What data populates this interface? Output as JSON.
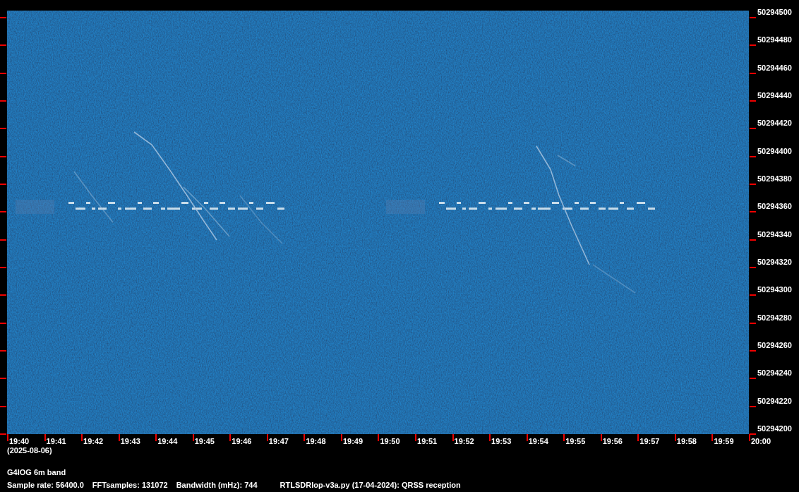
{
  "frequency_axis": {
    "labels": [
      "50294500",
      "50294480",
      "50294460",
      "50294440",
      "50294420",
      "50294400",
      "50294380",
      "50294360",
      "50294340",
      "50294320",
      "50294300",
      "50294280",
      "50294260",
      "50294240",
      "50294220",
      "50294200"
    ]
  },
  "time_axis": {
    "labels": [
      "19:40",
      "19:41",
      "19:42",
      "19:43",
      "19:44",
      "19:45",
      "19:46",
      "19:47",
      "19:48",
      "19:49",
      "19:50",
      "19:51",
      "19:52",
      "19:53",
      "19:54",
      "19:55",
      "19:56",
      "19:57",
      "19:58",
      "19:59",
      "20:00"
    ],
    "date": "(2025-08-06)"
  },
  "footer": {
    "title": "G4IOG 6m band",
    "details": [
      "Sample rate: 56400.0",
      "FFTsamples: 131072",
      "Bandwidth (mHz): 744"
    ],
    "program": "RTLSDRlop-v3a.py (17-04-2024): QRSS reception"
  }
}
